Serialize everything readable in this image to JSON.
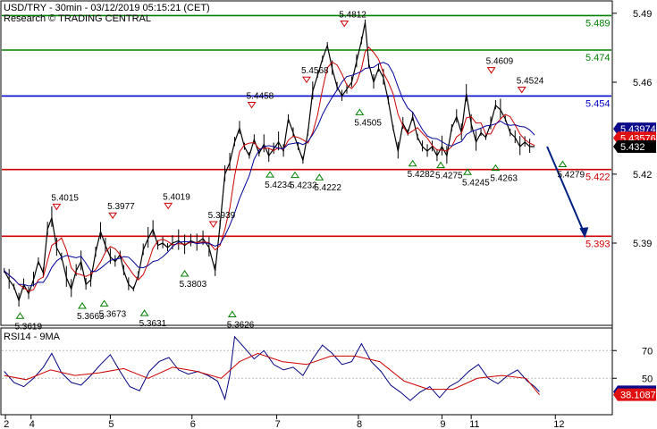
{
  "header": {
    "symbol_line": "USD/TRY - 30min - 03/12/2019 05:15:21 (CET)",
    "source_line": "Research © TRADING CENTRAL"
  },
  "rsi_title": "RSI14 - 9MA",
  "colors": {
    "background": "#ffffff",
    "price": "#000000",
    "ma_fast": "#cc0000",
    "ma_slow": "#000099",
    "resistance_green": "#008000",
    "pivot_blue": "#0000cc",
    "support_red": "#cc0000",
    "arrow": "#002080",
    "rsi_line": "#000080",
    "rsi_ma": "#cc0000",
    "grid": "#bbbbbb"
  },
  "chart_data": [
    {
      "type": "line",
      "title": "USD/TRY - 30min - 03/12/2019 05:15:21 (CET)",
      "x_tick_labels": [
        "2",
        "4",
        "5",
        "6",
        "7",
        "8",
        "9",
        "11",
        "12"
      ],
      "y_tick_labels": [
        "5.49",
        "5.46",
        "5.42",
        "5.39"
      ],
      "ylim": [
        5.355,
        5.495
      ],
      "levels": [
        {
          "value": 5.489,
          "label": "5.489",
          "kind": "resistance"
        },
        {
          "value": 5.474,
          "label": "5.474",
          "kind": "resistance"
        },
        {
          "value": 5.454,
          "label": "5.454",
          "kind": "pivot"
        },
        {
          "value": 5.422,
          "label": "5.422",
          "kind": "support"
        },
        {
          "value": 5.393,
          "label": "5.393",
          "kind": "support"
        }
      ],
      "price_tags": [
        {
          "value": 5.43974,
          "label": "5.43974",
          "style": "blue"
        },
        {
          "value": 5.43576,
          "label": "5.43576",
          "style": "red"
        },
        {
          "value": 5.432,
          "label": "5.432",
          "style": "black"
        }
      ],
      "price_path": [
        [
          0.004,
          5.378
        ],
        [
          0.012,
          5.374
        ],
        [
          0.02,
          5.371
        ],
        [
          0.028,
          5.365
        ],
        [
          0.036,
          5.372
        ],
        [
          0.044,
          5.368
        ],
        [
          0.052,
          5.374
        ],
        [
          0.06,
          5.382
        ],
        [
          0.068,
          5.377
        ],
        [
          0.075,
          5.396
        ],
        [
          0.082,
          5.401
        ],
        [
          0.09,
          5.388
        ],
        [
          0.098,
          5.384
        ],
        [
          0.106,
          5.375
        ],
        [
          0.114,
          5.37
        ],
        [
          0.122,
          5.378
        ],
        [
          0.13,
          5.382
        ],
        [
          0.138,
          5.372
        ],
        [
          0.146,
          5.374
        ],
        [
          0.154,
          5.386
        ],
        [
          0.162,
          5.395
        ],
        [
          0.17,
          5.389
        ],
        [
          0.178,
          5.384
        ],
        [
          0.186,
          5.382
        ],
        [
          0.194,
          5.385
        ],
        [
          0.2,
          5.378
        ],
        [
          0.208,
          5.372
        ],
        [
          0.216,
          5.37
        ],
        [
          0.224,
          5.376
        ],
        [
          0.232,
          5.387
        ],
        [
          0.24,
          5.392
        ],
        [
          0.248,
          5.396
        ],
        [
          0.256,
          5.389
        ],
        [
          0.264,
          5.39
        ],
        [
          0.272,
          5.388
        ],
        [
          0.28,
          5.39
        ],
        [
          0.29,
          5.391
        ],
        [
          0.3,
          5.389
        ],
        [
          0.31,
          5.391
        ],
        [
          0.32,
          5.39
        ],
        [
          0.33,
          5.392
        ],
        [
          0.34,
          5.388
        ],
        [
          0.35,
          5.378
        ],
        [
          0.358,
          5.398
        ],
        [
          0.366,
          5.42
        ],
        [
          0.374,
          5.425
        ],
        [
          0.382,
          5.434
        ],
        [
          0.39,
          5.44
        ],
        [
          0.398,
          5.432
        ],
        [
          0.406,
          5.428
        ],
        [
          0.414,
          5.435
        ],
        [
          0.422,
          5.429
        ],
        [
          0.43,
          5.433
        ],
        [
          0.438,
          5.428
        ],
        [
          0.446,
          5.431
        ],
        [
          0.454,
          5.434
        ],
        [
          0.462,
          5.43
        ],
        [
          0.47,
          5.444
        ],
        [
          0.478,
          5.438
        ],
        [
          0.486,
          5.432
        ],
        [
          0.494,
          5.426
        ],
        [
          0.502,
          5.438
        ],
        [
          0.51,
          5.456
        ],
        [
          0.518,
          5.463
        ],
        [
          0.526,
          5.47
        ],
        [
          0.534,
          5.476
        ],
        [
          0.542,
          5.466
        ],
        [
          0.55,
          5.458
        ],
        [
          0.558,
          5.454
        ],
        [
          0.566,
          5.457
        ],
        [
          0.574,
          5.46
        ],
        [
          0.582,
          5.469
        ],
        [
          0.59,
          5.478
        ],
        [
          0.596,
          5.486
        ],
        [
          0.602,
          5.468
        ],
        [
          0.61,
          5.46
        ],
        [
          0.618,
          5.466
        ],
        [
          0.626,
          5.462
        ],
        [
          0.634,
          5.452
        ],
        [
          0.642,
          5.44
        ],
        [
          0.65,
          5.43
        ],
        [
          0.658,
          5.442
        ],
        [
          0.666,
          5.438
        ],
        [
          0.674,
          5.445
        ],
        [
          0.682,
          5.436
        ],
        [
          0.69,
          5.432
        ],
        [
          0.698,
          5.43
        ],
        [
          0.706,
          5.432
        ],
        [
          0.714,
          5.428
        ],
        [
          0.722,
          5.432
        ],
        [
          0.73,
          5.428
        ],
        [
          0.738,
          5.44
        ],
        [
          0.746,
          5.445
        ],
        [
          0.754,
          5.438
        ],
        [
          0.762,
          5.455
        ],
        [
          0.77,
          5.442
        ],
        [
          0.778,
          5.434
        ],
        [
          0.786,
          5.438
        ],
        [
          0.794,
          5.436
        ],
        [
          0.802,
          5.442
        ],
        [
          0.81,
          5.45
        ],
        [
          0.818,
          5.448
        ],
        [
          0.826,
          5.444
        ],
        [
          0.834,
          5.438
        ],
        [
          0.842,
          5.436
        ],
        [
          0.85,
          5.432
        ],
        [
          0.858,
          5.434
        ],
        [
          0.866,
          5.432
        ],
        [
          0.874,
          5.432
        ]
      ],
      "projection": {
        "from": [
          0.874,
          5.432
        ],
        "to": [
          0.955,
          5.393
        ]
      },
      "annotations": [
        {
          "label": "5.3619",
          "value": 5.3619,
          "at": 0.03,
          "kind": "low"
        },
        {
          "label": "5.4015",
          "value": 5.4015,
          "at": 0.09,
          "kind": "high"
        },
        {
          "label": "5.3663",
          "value": 5.3663,
          "at": 0.132,
          "kind": "low"
        },
        {
          "label": "5.3977",
          "value": 5.3977,
          "at": 0.182,
          "kind": "high"
        },
        {
          "label": "5.3673",
          "value": 5.3673,
          "at": 0.168,
          "kind": "low"
        },
        {
          "label": "5.3631",
          "value": 5.3631,
          "at": 0.234,
          "kind": "low"
        },
        {
          "label": "5.4019",
          "value": 5.4019,
          "at": 0.273,
          "kind": "high"
        },
        {
          "label": "5.3803",
          "value": 5.3803,
          "at": 0.3,
          "kind": "low"
        },
        {
          "label": "5.3939",
          "value": 5.3939,
          "at": 0.347,
          "kind": "high"
        },
        {
          "label": "5.3626",
          "value": 5.3626,
          "at": 0.378,
          "kind": "low"
        },
        {
          "label": "5.4458",
          "value": 5.4458,
          "at": 0.41,
          "kind": "high"
        },
        {
          "label": "5.4234",
          "value": 5.4234,
          "at": 0.44,
          "kind": "low"
        },
        {
          "label": "5.4232",
          "value": 5.4232,
          "at": 0.481,
          "kind": "low"
        },
        {
          "label": "5.4222",
          "value": 5.4222,
          "at": 0.521,
          "kind": "low"
        },
        {
          "label": "5.4568",
          "value": 5.4568,
          "at": 0.5,
          "kind": "high"
        },
        {
          "label": "5.4812",
          "value": 5.4812,
          "at": 0.562,
          "kind": "high"
        },
        {
          "label": "5.4505",
          "value": 5.4505,
          "at": 0.587,
          "kind": "low"
        },
        {
          "label": "5.4282",
          "value": 5.4282,
          "at": 0.674,
          "kind": "low"
        },
        {
          "label": "5.4275",
          "value": 5.4275,
          "at": 0.72,
          "kind": "low"
        },
        {
          "label": "5.4245",
          "value": 5.4245,
          "at": 0.764,
          "kind": "low"
        },
        {
          "label": "5.4609",
          "value": 5.4609,
          "at": 0.803,
          "kind": "high"
        },
        {
          "label": "5.4263",
          "value": 5.4263,
          "at": 0.81,
          "kind": "low"
        },
        {
          "label": "5.4524",
          "value": 5.4524,
          "at": 0.853,
          "kind": "high"
        },
        {
          "label": "5.4279",
          "value": 5.4279,
          "at": 0.92,
          "kind": "low"
        }
      ]
    },
    {
      "type": "line",
      "title": "RSI14 - 9MA",
      "y_tick_labels": [
        "70",
        "50"
      ],
      "ylim": [
        25,
        85
      ],
      "value_tags": [
        {
          "value": 40.2379,
          "label": "40.2379",
          "style": "blue"
        },
        {
          "value": 38.1087,
          "label": "38.1087",
          "style": "red"
        }
      ],
      "rsi_path": [
        [
          0.004,
          55
        ],
        [
          0.02,
          47
        ],
        [
          0.036,
          44
        ],
        [
          0.052,
          50
        ],
        [
          0.068,
          58
        ],
        [
          0.082,
          68
        ],
        [
          0.098,
          54
        ],
        [
          0.114,
          47
        ],
        [
          0.13,
          45
        ],
        [
          0.146,
          52
        ],
        [
          0.162,
          60
        ],
        [
          0.178,
          67
        ],
        [
          0.194,
          55
        ],
        [
          0.21,
          44
        ],
        [
          0.226,
          41
        ],
        [
          0.242,
          55
        ],
        [
          0.258,
          62
        ],
        [
          0.274,
          65
        ],
        [
          0.29,
          56
        ],
        [
          0.306,
          53
        ],
        [
          0.322,
          55
        ],
        [
          0.338,
          52
        ],
        [
          0.354,
          48
        ],
        [
          0.366,
          35
        ],
        [
          0.374,
          52
        ],
        [
          0.382,
          80
        ],
        [
          0.398,
          72
        ],
        [
          0.414,
          64
        ],
        [
          0.43,
          70
        ],
        [
          0.446,
          60
        ],
        [
          0.462,
          56
        ],
        [
          0.478,
          58
        ],
        [
          0.494,
          52
        ],
        [
          0.51,
          64
        ],
        [
          0.526,
          74
        ],
        [
          0.542,
          68
        ],
        [
          0.558,
          60
        ],
        [
          0.574,
          62
        ],
        [
          0.59,
          75
        ],
        [
          0.606,
          62
        ],
        [
          0.622,
          55
        ],
        [
          0.638,
          45
        ],
        [
          0.654,
          40
        ],
        [
          0.67,
          34
        ],
        [
          0.686,
          40
        ],
        [
          0.702,
          44
        ],
        [
          0.718,
          36
        ],
        [
          0.734,
          44
        ],
        [
          0.75,
          48
        ],
        [
          0.766,
          55
        ],
        [
          0.782,
          60
        ],
        [
          0.798,
          50
        ],
        [
          0.814,
          46
        ],
        [
          0.83,
          52
        ],
        [
          0.846,
          56
        ],
        [
          0.862,
          48
        ],
        [
          0.874,
          44
        ],
        [
          0.882,
          40.2
        ]
      ],
      "rsi_ma_path": [
        [
          0.004,
          52
        ],
        [
          0.04,
          49
        ],
        [
          0.08,
          56
        ],
        [
          0.12,
          52
        ],
        [
          0.16,
          54
        ],
        [
          0.2,
          57
        ],
        [
          0.24,
          50
        ],
        [
          0.28,
          58
        ],
        [
          0.32,
          55
        ],
        [
          0.36,
          50
        ],
        [
          0.39,
          62
        ],
        [
          0.42,
          68
        ],
        [
          0.46,
          62
        ],
        [
          0.5,
          60
        ],
        [
          0.54,
          66
        ],
        [
          0.58,
          66
        ],
        [
          0.62,
          62
        ],
        [
          0.66,
          48
        ],
        [
          0.7,
          42
        ],
        [
          0.74,
          42
        ],
        [
          0.78,
          50
        ],
        [
          0.82,
          52
        ],
        [
          0.86,
          50
        ],
        [
          0.882,
          38.1
        ]
      ]
    }
  ]
}
